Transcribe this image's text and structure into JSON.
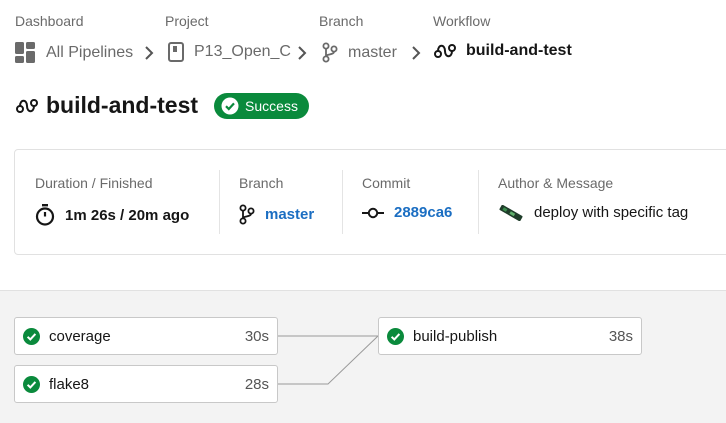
{
  "breadcrumbs": [
    {
      "label": "Dashboard",
      "value": "All Pipelines",
      "icon": "dashboard-icon"
    },
    {
      "label": "Project",
      "value": "P13_Open_C",
      "icon": "project-icon"
    },
    {
      "label": "Branch",
      "value": "master",
      "icon": "branch-icon"
    },
    {
      "label": "Workflow",
      "value": "build-and-test",
      "icon": "workflow-icon"
    }
  ],
  "header": {
    "title": "build-and-test",
    "status": "Success",
    "status_color": "#0a8a3c"
  },
  "summary": {
    "duration_label": "Duration / Finished",
    "duration_value": "1m 26s / 20m ago",
    "branch_label": "Branch",
    "branch_value": "master",
    "commit_label": "Commit",
    "commit_value": "2889ca6",
    "author_label": "Author & Message",
    "author_message": "deploy with specific tag"
  },
  "jobs": [
    {
      "name": "coverage",
      "duration": "30s",
      "status": "success"
    },
    {
      "name": "flake8",
      "duration": "28s",
      "status": "success"
    },
    {
      "name": "build-publish",
      "duration": "38s",
      "status": "success"
    }
  ],
  "colors": {
    "link": "#1b6ec2",
    "success": "#0a8a3c"
  }
}
